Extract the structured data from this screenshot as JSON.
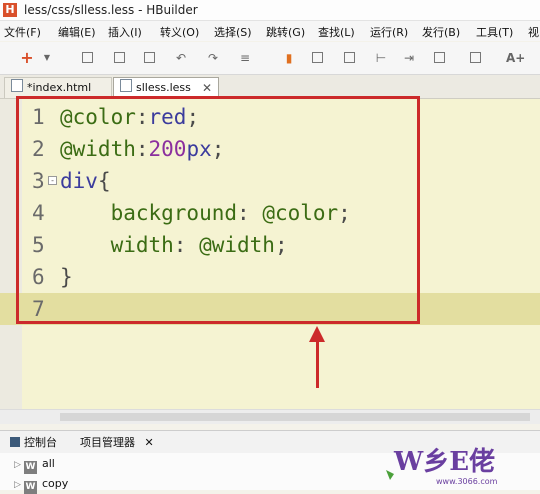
{
  "window": {
    "title": "less/css/slless.less  -  HBuilder",
    "app_icon_letter": "H"
  },
  "menu": [
    "文件(F)",
    "编辑(E)",
    "插入(I)",
    "转义(O)",
    "选择(S)",
    "跳转(G)",
    "查找(L)",
    "运行(R)",
    "发行(B)",
    "工具(T)",
    "视"
  ],
  "toolbar": {
    "icons": [
      "add-icon",
      "dropdown-icon",
      "save-icon",
      "save-all-icon",
      "copy-icon",
      "undo-icon",
      "redo-icon",
      "comment-icon",
      "bookmark-icon",
      "open-icon",
      "terminal-icon",
      "step-icon",
      "indent-icon",
      "outdent-icon",
      "preview-icon",
      "device-icon",
      "font-size-icon"
    ],
    "font_size_label": "A+"
  },
  "tabs": [
    {
      "label": "*index.html",
      "active": false
    },
    {
      "label": "slless.less",
      "active": true,
      "close": "✕"
    }
  ],
  "editor": {
    "lines": [
      {
        "n": "1",
        "tokens": [
          {
            "t": "@color",
            "c": "c-var"
          },
          {
            "t": ":",
            "c": "c-punc"
          },
          {
            "t": "red",
            "c": "c-tag"
          },
          {
            "t": ";",
            "c": "c-punc"
          }
        ]
      },
      {
        "n": "2",
        "tokens": [
          {
            "t": "@width",
            "c": "c-var"
          },
          {
            "t": ":",
            "c": "c-punc"
          },
          {
            "t": "200",
            "c": "c-num"
          },
          {
            "t": "px",
            "c": "c-tag"
          },
          {
            "t": ";",
            "c": "c-punc"
          }
        ]
      },
      {
        "n": "3",
        "fold": "-",
        "tokens": [
          {
            "t": "div",
            "c": "c-tag"
          },
          {
            "t": "{",
            "c": "c-punc"
          }
        ]
      },
      {
        "n": "4",
        "tokens": [
          {
            "t": "    background",
            "c": "c-var"
          },
          {
            "t": ": ",
            "c": "c-punc"
          },
          {
            "t": "@color",
            "c": "c-var"
          },
          {
            "t": ";",
            "c": "c-punc"
          }
        ]
      },
      {
        "n": "5",
        "tokens": [
          {
            "t": "    width",
            "c": "c-var"
          },
          {
            "t": ": ",
            "c": "c-punc"
          },
          {
            "t": "@width",
            "c": "c-var"
          },
          {
            "t": ";",
            "c": "c-punc"
          }
        ]
      },
      {
        "n": "6",
        "tokens": [
          {
            "t": "}",
            "c": "c-punc"
          }
        ]
      },
      {
        "n": "7",
        "current": true,
        "tokens": []
      }
    ]
  },
  "bottom_panel": {
    "tabs": [
      {
        "label": "控制台"
      },
      {
        "label": "项目管理器",
        "close": "✕"
      }
    ],
    "tree": [
      {
        "arrow": "▷",
        "icon": "W",
        "label": "all"
      },
      {
        "arrow": "▷",
        "icon": "W",
        "label": "copy"
      }
    ]
  },
  "watermark": {
    "text": "W乡E佬",
    "url": "www.3066.com"
  },
  "colors": {
    "annotation": "#cc2a2a",
    "editor_bg": "#f5f3d2",
    "current_line": "#e3dea0"
  }
}
